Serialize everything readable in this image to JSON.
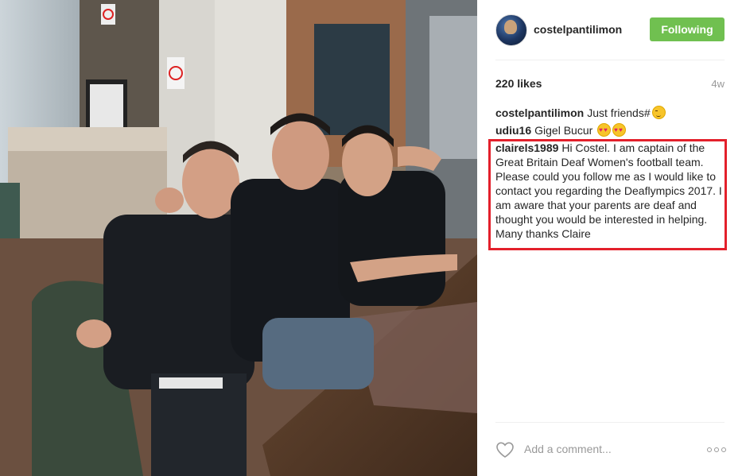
{
  "post": {
    "username": "costelpantilimon",
    "follow_label": "Following",
    "likes": "220 likes",
    "time": "4w"
  },
  "comments": [
    {
      "author": "costelpantilimon",
      "text": "Just friends#",
      "emoji": "winking-face"
    },
    {
      "author": "udiu16",
      "text": "Gigel Bucur",
      "emoji": "heart-eyes-face"
    },
    {
      "author": "clairels1989",
      "text": "Hi Costel. I am captain of the Great Britain Deaf Women's football team. Please could you follow me as I would like to contact you regarding the Deaflympics 2017. I am aware that your parents are deaf and thought you would be interested in helping. Many thanks Claire"
    }
  ],
  "footer": {
    "comment_placeholder": "Add a comment..."
  },
  "colors": {
    "follow_button": "#70c050",
    "highlight_border": "#e3202b",
    "muted_text": "#999999"
  },
  "icons": {
    "like": "heart-outline-icon",
    "more": "more-options-icon"
  }
}
